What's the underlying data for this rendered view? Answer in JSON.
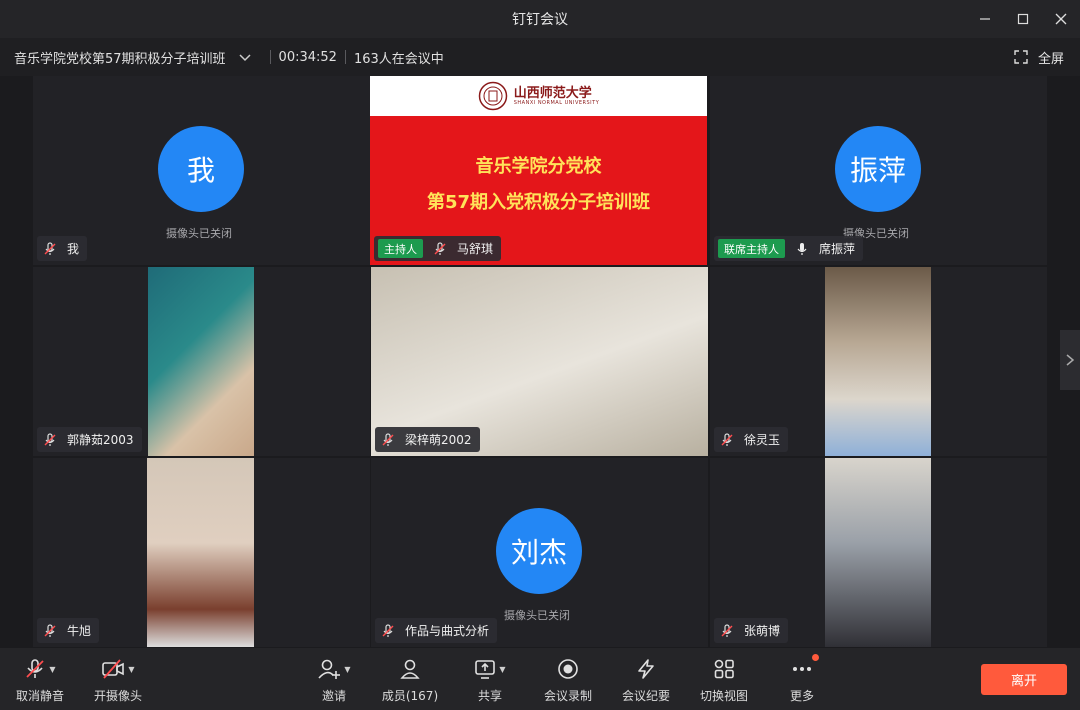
{
  "window": {
    "title": "钉钉会议"
  },
  "meeting": {
    "title": "音乐学院党校第57期积极分子培训班",
    "duration": "00:34:52",
    "participants_text": "163人在会议中",
    "fullscreen_label": "全屏"
  },
  "tiles": {
    "me": {
      "avatar": "我",
      "cam_off": "摄像头已关闭",
      "name": "我"
    },
    "slide": {
      "host_badge": "主持人",
      "name": "马舒琪",
      "line1": "音乐学院分党校",
      "line2": "第57期入党积极分子培训班",
      "logo_cn": "山西师范大学",
      "logo_en": "SHANXI NORMAL UNIVERSITY"
    },
    "zhenping": {
      "avatar": "振萍",
      "cam_off": "摄像头已关闭",
      "cohost_badge": "联席主持人",
      "name": "席振萍"
    },
    "guo": {
      "name": "郭静茹2003"
    },
    "liang": {
      "name": "梁梓萌2002"
    },
    "xu": {
      "name": "徐灵玉"
    },
    "niu": {
      "name": "牛旭"
    },
    "liu": {
      "avatar": "刘杰",
      "cam_off": "摄像头已关闭",
      "name": "作品与曲式分析"
    },
    "zhang": {
      "name": "张萌博"
    }
  },
  "toolbar": {
    "unmute": "取消静音",
    "camera": "开摄像头",
    "invite": "邀请",
    "members": "成员(167)",
    "share": "共享",
    "record": "会议录制",
    "minutes": "会议纪要",
    "view": "切换视图",
    "more": "更多",
    "leave": "离开"
  },
  "colors": {
    "accent": "#2387f5",
    "leave": "#ff5a3c",
    "host": "#1d9b4f",
    "slide_red": "#e4161a"
  }
}
